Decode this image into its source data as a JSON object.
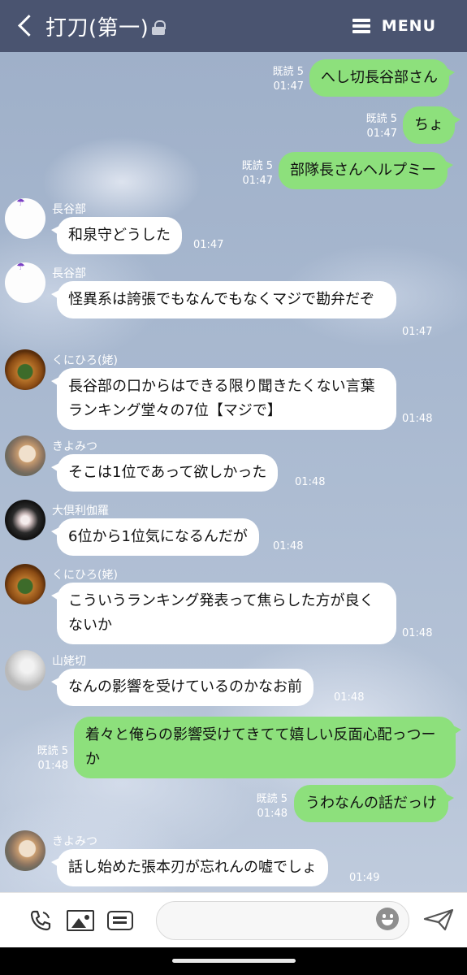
{
  "header": {
    "back_icon": "chevron-left-icon",
    "title": "打刀(第一)",
    "lock_icon": "lock-icon",
    "menu_icon": "hamburger-icon",
    "menu_label": "MENU"
  },
  "messages": [
    {
      "dir": "out",
      "read": "既読 5",
      "time": "01:47",
      "text": "へし切長谷部さん"
    },
    {
      "dir": "out",
      "read": "既読 5",
      "time": "01:47",
      "text": "ちょ"
    },
    {
      "dir": "out",
      "read": "既読 5",
      "time": "01:47",
      "text": "部隊長さんヘルプミー"
    },
    {
      "dir": "in",
      "sender": "長谷部",
      "time": "01:47",
      "text": "和泉守どうした"
    },
    {
      "dir": "in",
      "sender": "長谷部",
      "time": "01:47",
      "text": "怪異系は誇張でもなんでもなくマジで勘弁だぞ"
    },
    {
      "dir": "in",
      "sender": "くにひろ(姥)",
      "time": "01:48",
      "text": "長谷部の口からはできる限り聞きたくない言葉ランキング堂々の7位【マジで】"
    },
    {
      "dir": "in",
      "sender": "きよみつ",
      "time": "01:48",
      "text": "そこは1位であって欲しかった"
    },
    {
      "dir": "in",
      "sender": "大倶利伽羅",
      "time": "01:48",
      "text": "6位から1位気になるんだが"
    },
    {
      "dir": "in",
      "sender": "くにひろ(姥)",
      "time": "01:48",
      "text": "こういうランキング発表って焦らした方が良くないか"
    },
    {
      "dir": "in",
      "sender": "山姥切",
      "time": "01:48",
      "text": "なんの影響を受けているのかなお前"
    },
    {
      "dir": "out",
      "read": "既読 5",
      "time": "01:48",
      "text": "着々と俺らの影響受けてきてて嬉しい反面心配っつーか"
    },
    {
      "dir": "out",
      "read": "既読 5",
      "time": "01:48",
      "text": "うわなんの話だっけ"
    },
    {
      "dir": "in",
      "sender": "きよみつ",
      "time": "01:49",
      "text": "話し始めた張本刃が忘れんの嘘でしょ"
    }
  ],
  "input": {
    "phone_icon": "phone-icon",
    "image_icon": "image-icon",
    "note_icon": "note-icon",
    "emoji_icon": "emoji-icon",
    "send_icon": "send-icon",
    "placeholder": ""
  },
  "colors": {
    "header_bg": "#4a5470",
    "outgoing_bubble": "#8de07c",
    "incoming_bubble": "#ffffff"
  }
}
